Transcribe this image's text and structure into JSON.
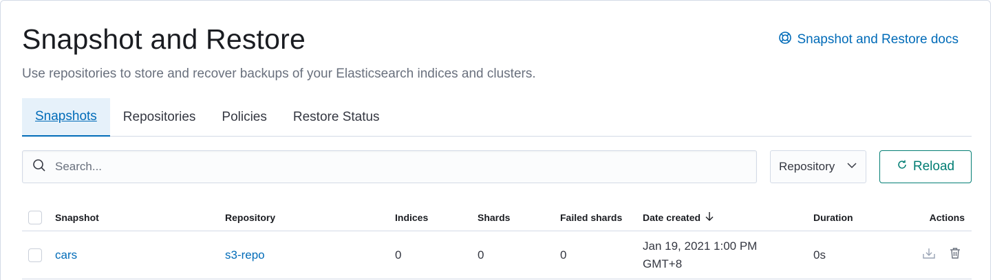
{
  "header": {
    "title": "Snapshot and Restore",
    "subtitle": "Use repositories to store and recover backups of your Elasticsearch indices and clusters.",
    "docs_link": "Snapshot and Restore docs",
    "docs_icon": "help-lifebuoy-icon"
  },
  "tabs": [
    {
      "label": "Snapshots",
      "active": true
    },
    {
      "label": "Repositories",
      "active": false
    },
    {
      "label": "Policies",
      "active": false
    },
    {
      "label": "Restore Status",
      "active": false
    }
  ],
  "toolbar": {
    "search_placeholder": "Search...",
    "search_value": "",
    "repository_filter": "Repository",
    "reload_label": "Reload"
  },
  "table": {
    "columns": [
      "Snapshot",
      "Repository",
      "Indices",
      "Shards",
      "Failed shards",
      "Date created",
      "Duration",
      "Actions"
    ],
    "sort_column": "Date created",
    "sort_direction": "descending",
    "rows": [
      {
        "snapshot": "cars",
        "repository": "s3-repo",
        "indices": "0",
        "shards": "0",
        "failed_shards": "0",
        "date_line1": "Jan 19, 2021 1:00 PM",
        "date_line2": "GMT+8",
        "duration": "0s",
        "actions": [
          "restore-icon",
          "trash-icon"
        ]
      }
    ]
  },
  "colors": {
    "accent": "#006bb8",
    "success": "#017d73",
    "border": "#d3dae6",
    "text": "#343741",
    "subdued": "#69707d"
  }
}
